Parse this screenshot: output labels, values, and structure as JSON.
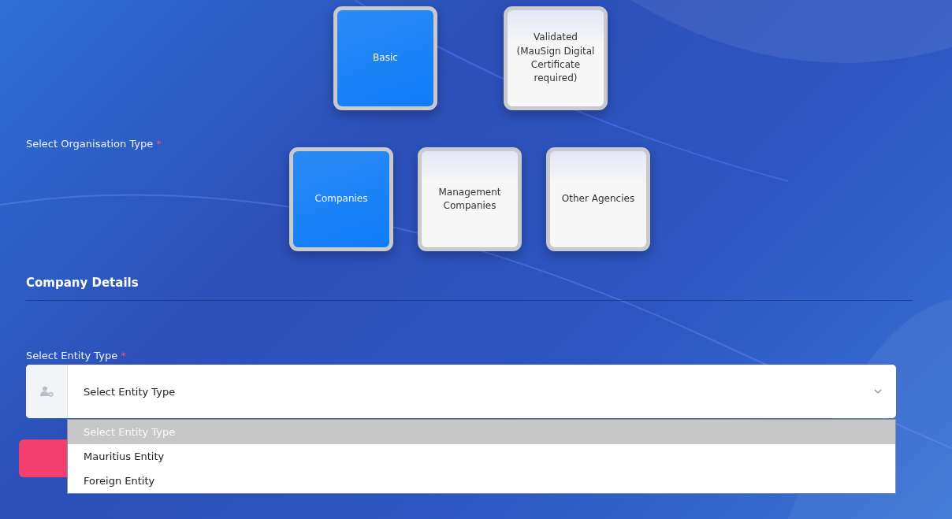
{
  "verification_options": [
    {
      "label": "Basic",
      "selected": true
    },
    {
      "label": "Validated (MauSign Digital Certificate required)",
      "selected": false
    }
  ],
  "organisation_type": {
    "label": "Select Organisation Type",
    "required_mark": "*",
    "options": [
      {
        "label": "Companies",
        "selected": true
      },
      {
        "label": "Management Companies",
        "selected": false
      },
      {
        "label": "Other Agencies",
        "selected": false
      }
    ]
  },
  "section_title": "Company Details",
  "entity_type": {
    "label": "Select Entity Type",
    "required_mark": "*",
    "value": "Select Entity Type",
    "expanded": true,
    "options": [
      {
        "label": "Select Entity Type",
        "selected": true
      },
      {
        "label": "Mauritius Entity",
        "selected": false
      },
      {
        "label": "Foreign Entity",
        "selected": false
      }
    ]
  }
}
